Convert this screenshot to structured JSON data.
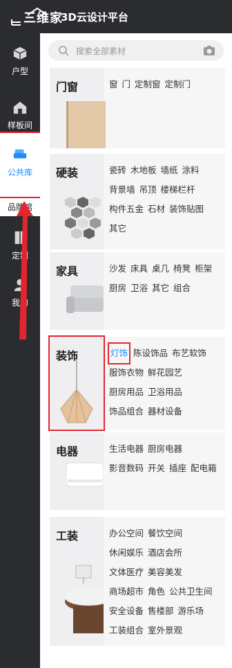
{
  "app": {
    "brand": "三维家",
    "title": "3D云设计平台"
  },
  "search": {
    "placeholder": "搜索全部素材"
  },
  "sidebar": {
    "items": [
      {
        "label": "户型"
      },
      {
        "label": "样板间"
      },
      {
        "label": "公共库"
      },
      {
        "label": "定制"
      },
      {
        "label": "我的"
      }
    ],
    "overlap_label": "品牌馆"
  },
  "categories": [
    {
      "name": "门窗",
      "links": [
        "窗",
        "门",
        "定制窗",
        "定制门"
      ]
    },
    {
      "name": "硬装",
      "links": [
        "瓷砖",
        "木地板",
        "墙纸",
        "涂料",
        "背景墙",
        "吊顶",
        "楼梯栏杆",
        "构件五金",
        "石材",
        "装饰贴图",
        "其它"
      ]
    },
    {
      "name": "家具",
      "links": [
        "沙发",
        "床具",
        "桌几",
        "椅凳",
        "柜架",
        "厨房",
        "卫浴",
        "其它",
        "组合"
      ]
    },
    {
      "name": "装饰",
      "links": [
        "灯饰",
        "陈设饰品",
        "布艺软饰",
        "服饰衣物",
        "鲜花园艺",
        "厨房用品",
        "卫浴用品",
        "饰品组合",
        "器材设备"
      ]
    },
    {
      "name": "电器",
      "links": [
        "生活电器",
        "厨房电器",
        "影音数码",
        "开关",
        "插座",
        "配电箱"
      ]
    },
    {
      "name": "工装",
      "links": [
        "办公空间",
        "餐饮空间",
        "休闲娱乐",
        "酒店会所",
        "文体医疗",
        "美容美发",
        "商场超市",
        "角色",
        "公共卫生间",
        "安全设备",
        "售楼部",
        "游乐场",
        "工装组合",
        "室外景观"
      ]
    }
  ],
  "colors": {
    "accent": "#1a8cff",
    "highlight": "#e4252f",
    "dark": "#2b2c30"
  }
}
